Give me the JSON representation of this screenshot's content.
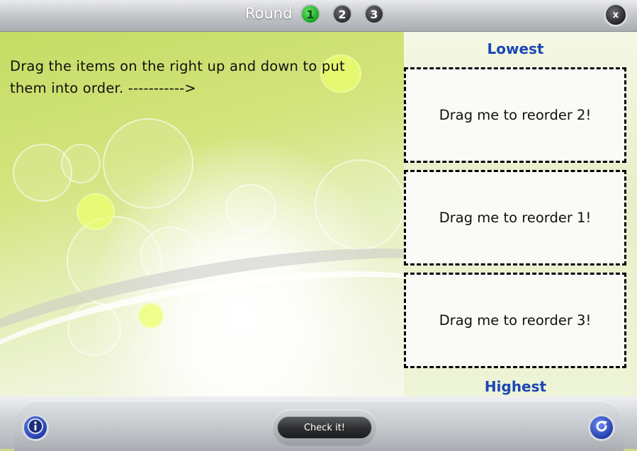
{
  "header": {
    "round_label": "Round",
    "rounds": [
      "1",
      "2",
      "3"
    ],
    "active_round": "1",
    "close_label": "x"
  },
  "instructions": "Drag the items on the right up and down to put them into order. ----------->",
  "panel": {
    "top_label": "Lowest",
    "bottom_label": "Highest",
    "items": [
      "Drag me to reorder 2!",
      "Drag me to reorder 1!",
      "Drag me to reorder 3!"
    ]
  },
  "footer": {
    "check_label": "Check it!",
    "info_icon": "info-icon",
    "reset_icon": "refresh-icon"
  },
  "colors": {
    "accent_label": "#1b47b5",
    "active_round": "#16a322"
  }
}
